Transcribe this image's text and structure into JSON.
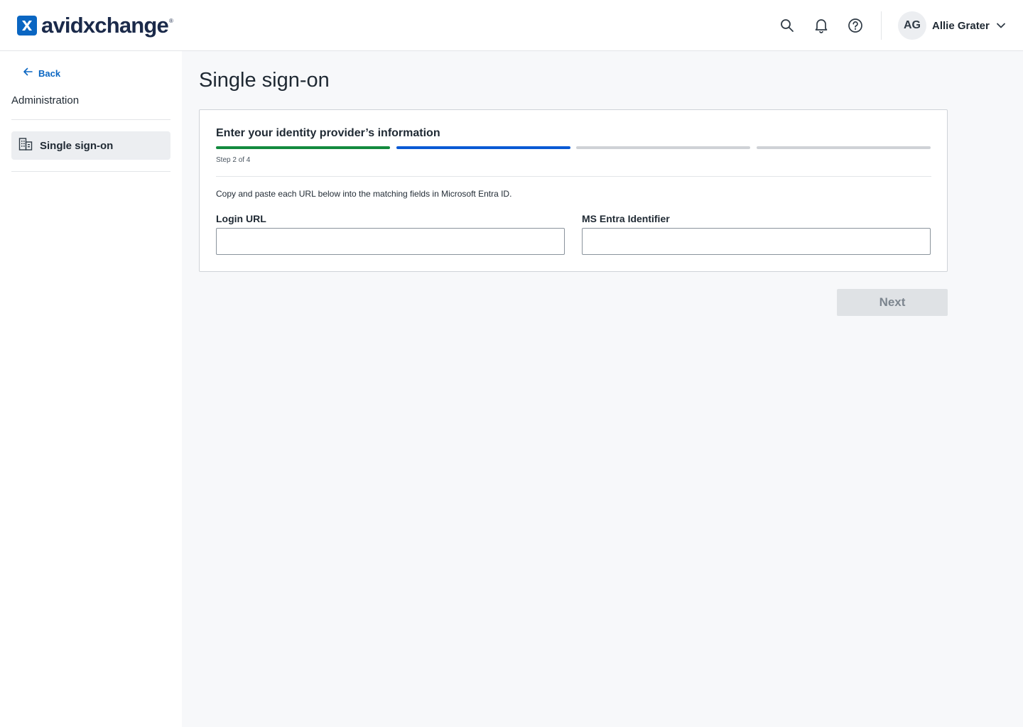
{
  "header": {
    "logo_text": "avidxchange",
    "logo_reg": "®",
    "icons": [
      "search-icon",
      "bell-icon",
      "help-icon",
      "chevron-down-icon"
    ],
    "user": {
      "initials": "AG",
      "name": "Allie Grater"
    }
  },
  "sidebar": {
    "back_label": "Back",
    "section_title": "Administration",
    "items": [
      {
        "label": "Single sign-on",
        "icon": "building-icon",
        "active": true
      }
    ]
  },
  "main": {
    "title": "Single sign-on",
    "card": {
      "title": "Enter your identity provider’s information",
      "step_label": "Step 2 of 4",
      "steps": [
        {
          "state": "complete",
          "color": "#138a3e"
        },
        {
          "state": "current",
          "color": "#0a5ad4"
        },
        {
          "state": "upcoming",
          "color": "#cfd2d6"
        },
        {
          "state": "upcoming",
          "color": "#cfd2d6"
        }
      ],
      "description": "Copy and paste each URL below into the matching fields in Microsoft Entra ID.",
      "fields": [
        {
          "label": "Login URL",
          "value": "",
          "placeholder": ""
        },
        {
          "label": "MS Entra Identifier",
          "value": "",
          "placeholder": ""
        }
      ]
    },
    "next_label": "Next"
  },
  "colors": {
    "accent": "#0a66c2",
    "brand_dark": "#1b2a4a",
    "disabled_bg": "#dfe2e5"
  }
}
